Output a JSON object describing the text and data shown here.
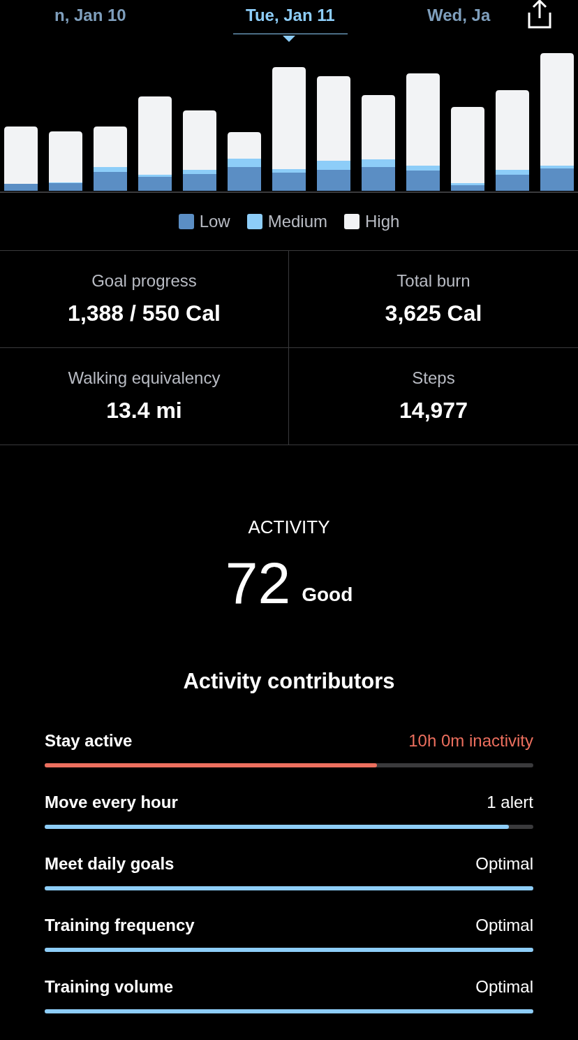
{
  "date_tabs": [
    {
      "label": "n, Jan 10",
      "selected": false
    },
    {
      "label": "Tue, Jan 11",
      "selected": true
    },
    {
      "label": "Wed, Ja",
      "selected": false
    }
  ],
  "legend": [
    {
      "label": "Low",
      "color": "#5b8ec4"
    },
    {
      "label": "Medium",
      "color": "#8dcdf8"
    },
    {
      "label": "High",
      "color": "#f2f3f5"
    }
  ],
  "stats": [
    {
      "label": "Goal progress",
      "value": "1,388 / 550 Cal"
    },
    {
      "label": "Total burn",
      "value": "3,625 Cal"
    },
    {
      "label": "Walking equivalency",
      "value": "13.4 mi"
    },
    {
      "label": "Steps",
      "value": "14,977"
    }
  ],
  "score": {
    "title": "ACTIVITY",
    "value": "72",
    "rating": "Good"
  },
  "contributors_title": "Activity contributors",
  "contributors": [
    {
      "name": "Stay active",
      "value": "10h 0m inactivity",
      "attention": true,
      "level": 0.68
    },
    {
      "name": "Move every hour",
      "value": "1 alert",
      "attention": false,
      "level": 0.95
    },
    {
      "name": "Meet daily goals",
      "value": "Optimal",
      "attention": false,
      "level": 1
    },
    {
      "name": "Training frequency",
      "value": "Optimal",
      "attention": false,
      "level": 1
    },
    {
      "name": "Training volume",
      "value": "Optimal",
      "attention": false,
      "level": 1
    }
  ]
}
